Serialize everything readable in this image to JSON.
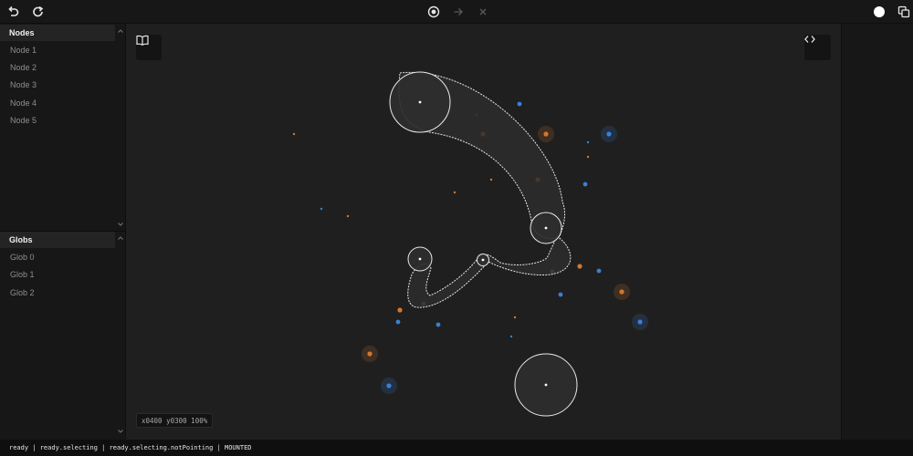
{
  "toolbar": {
    "icons": [
      "undo-icon",
      "redo-icon",
      "select-target-icon",
      "arrow-right-icon",
      "close-icon",
      "color-swatch-icon",
      "duplicate-icon"
    ]
  },
  "left_panel": {
    "nodes_header": "Nodes",
    "nodes": [
      "Node 1",
      "Node 2",
      "Node 3",
      "Node 4",
      "Node 5"
    ],
    "globs_header": "Globs",
    "globs": [
      "Glob 0",
      "Glob 1",
      "Glob 2"
    ]
  },
  "canvas": {
    "coordinates_readout": "x0400 y0300 100%",
    "icons": [
      "book-icon",
      "code-icon"
    ],
    "colors": {
      "background": "#1f1f1f",
      "outline": "#e8e8e8",
      "glob_fill": "#2d2d2d",
      "orange": "#d07832",
      "blue": "#3a7fd6"
    }
  },
  "status_bar": {
    "text": "ready | ready.selecting | ready.selecting.notPointing | MOUNTED"
  }
}
